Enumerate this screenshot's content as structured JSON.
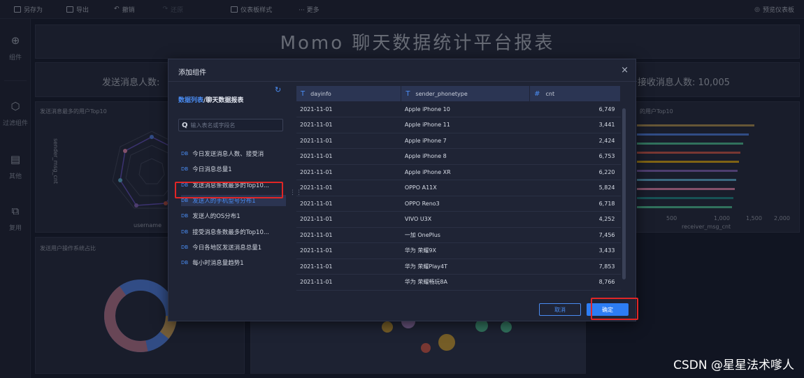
{
  "toolbar": {
    "items": [
      {
        "label": "另存为",
        "icon": "save-icon"
      },
      {
        "label": "导出",
        "icon": "export-icon"
      },
      {
        "label": "撤销",
        "icon": "undo-icon"
      },
      {
        "label": "还原",
        "icon": "redo-icon"
      },
      {
        "label": "仪表板样式",
        "icon": "style-icon"
      },
      {
        "label": "··· 更多",
        "icon": "more-icon"
      }
    ],
    "preview_label": "预览仪表板"
  },
  "sidebar": {
    "items": [
      {
        "label": "组件",
        "icon": "plus-circle-icon"
      },
      {
        "label": "过滤组件",
        "icon": "filter-icon"
      },
      {
        "label": "其他",
        "icon": "doc-icon"
      },
      {
        "label": "复用",
        "icon": "reuse-icon"
      }
    ]
  },
  "dashboard": {
    "title": "Momo 聊天数据统计平台报表",
    "kpi_send": "发送消息人数:",
    "kpi_receive": "接收消息人数: 10,005",
    "chart1_title": "发送消息最多的用户Top10",
    "chart2_title": "的用户Top10",
    "chart3_title": "发送用户操作系统占比",
    "radar_axis_y": "sender_msg_cnt",
    "radar_axis_x": "username",
    "bar_axis_x": "receiver_msg_cnt",
    "bar_ticks": [
      "500",
      "1,000",
      "1,500",
      "2,000"
    ]
  },
  "modal": {
    "title": "添加组件",
    "close": "×",
    "crumb_link": "数据列表",
    "crumb_sep": "/",
    "crumb_current": "聊天数据报表",
    "search_placeholder": "输入表名或字段名",
    "datasets": [
      "今日发送消息人数、接受消",
      "今日消息总量1",
      "发送消息条数最多的Top10...",
      "发送人的手机型号分布1",
      "发送人的OS分布1",
      "接受消息条数最多的Top10...",
      "今日各地区发送消息总量1",
      "每小时消息量趋势1"
    ],
    "dataset_tag": "DB",
    "active_index": 3,
    "columns": [
      {
        "type": "T",
        "name": "dayinfo"
      },
      {
        "type": "T",
        "name": "sender_phonetype"
      },
      {
        "type": "#",
        "name": "cnt"
      }
    ],
    "rows": [
      [
        "2021-11-01",
        "Apple iPhone 10",
        "6,749"
      ],
      [
        "2021-11-01",
        "Apple iPhone 11",
        "3,441"
      ],
      [
        "2021-11-01",
        "Apple iPhone 7",
        "2,424"
      ],
      [
        "2021-11-01",
        "Apple iPhone 8",
        "6,753"
      ],
      [
        "2021-11-01",
        "Apple iPhone XR",
        "6,220"
      ],
      [
        "2021-11-01",
        "OPPO A11X",
        "5,824"
      ],
      [
        "2021-11-01",
        "OPPO Reno3",
        "6,718"
      ],
      [
        "2021-11-01",
        "VIVO U3X",
        "4,252"
      ],
      [
        "2021-11-01",
        "一加 OnePlus",
        "7,456"
      ],
      [
        "2021-11-01",
        "华为 荣耀9X",
        "3,433"
      ],
      [
        "2021-11-01",
        "华为 荣耀Play4T",
        "7,853"
      ],
      [
        "2021-11-01",
        "华为 荣耀畅玩8A",
        "8,766"
      ]
    ],
    "cancel_label": "取消",
    "ok_label": "确定"
  },
  "watermark": "CSDN @星星法术嗲人"
}
